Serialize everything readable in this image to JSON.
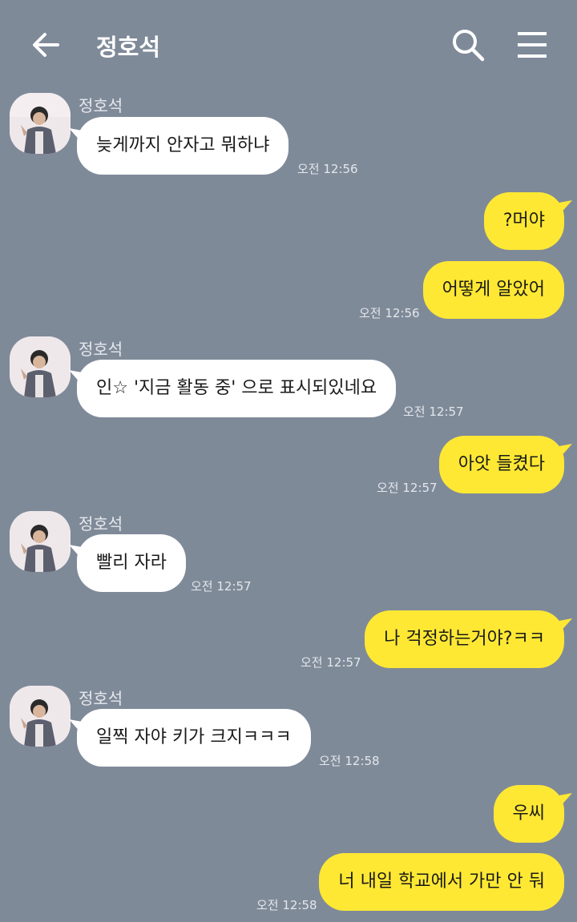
{
  "header": {
    "title": "정호석",
    "back_icon": "arrow-left-icon",
    "search_icon": "search-icon",
    "menu_icon": "hamburger-menu-icon"
  },
  "colors": {
    "background": "#7f8a99",
    "incoming_bubble": "#ffffff",
    "outgoing_bubble": "#fee834"
  },
  "messages": [
    {
      "sender": "정호석",
      "text": "늦게까지 안자고 뭐하냐",
      "time": "오전 12:56"
    },
    {
      "text": "?머야"
    },
    {
      "text": "어떻게 알았어",
      "time": "오전 12:56"
    },
    {
      "sender": "정호석",
      "text": "인☆ '지금 활동 중' 으로 표시되있네요",
      "time": "오전 12:57"
    },
    {
      "text": "아앗 들켰다",
      "time": "오전 12:57"
    },
    {
      "sender": "정호석",
      "text": "빨리 자라",
      "time": "오전 12:57"
    },
    {
      "text": "나 걱정하는거야?ㅋㅋ",
      "time": "오전 12:57"
    },
    {
      "sender": "정호석",
      "text": "일찍 자야 키가 크지ㅋㅋㅋ",
      "time": "오전 12:58"
    },
    {
      "text": "우씨"
    },
    {
      "text": "너 내일 학교에서 가만 안 둬",
      "time": "오전 12:58"
    }
  ]
}
